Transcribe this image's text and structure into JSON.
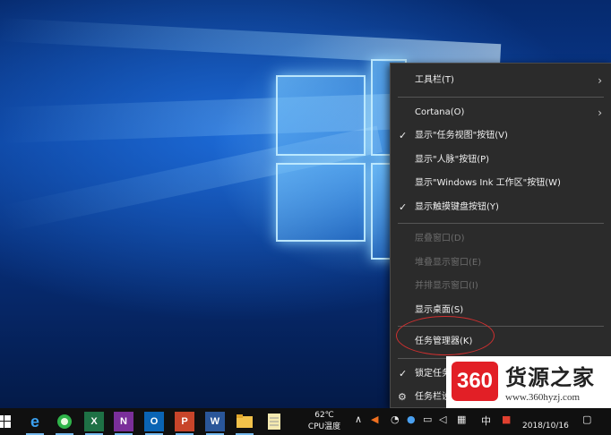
{
  "context_menu": {
    "items": [
      {
        "label": "工具栏(T)",
        "checked": false,
        "submenu": true,
        "enabled": true
      },
      {
        "label": "Cortana(O)",
        "checked": false,
        "submenu": true,
        "enabled": true
      },
      {
        "label": "显示\"任务视图\"按钮(V)",
        "checked": true,
        "submenu": false,
        "enabled": true
      },
      {
        "label": "显示\"人脉\"按钮(P)",
        "checked": false,
        "submenu": false,
        "enabled": true
      },
      {
        "label": "显示\"Windows Ink 工作区\"按钮(W)",
        "checked": false,
        "submenu": false,
        "enabled": true
      },
      {
        "label": "显示触摸键盘按钮(Y)",
        "checked": true,
        "submenu": false,
        "enabled": true
      },
      {
        "label": "层叠窗口(D)",
        "checked": false,
        "submenu": false,
        "enabled": false
      },
      {
        "label": "堆叠显示窗口(E)",
        "checked": false,
        "submenu": false,
        "enabled": false
      },
      {
        "label": "并排显示窗口(I)",
        "checked": false,
        "submenu": false,
        "enabled": false
      },
      {
        "label": "显示桌面(S)",
        "checked": false,
        "submenu": false,
        "enabled": true
      },
      {
        "label": "任务管理器(K)",
        "checked": false,
        "submenu": false,
        "enabled": true
      },
      {
        "label": "锁定任务",
        "checked": true,
        "submenu": false,
        "enabled": true
      },
      {
        "label": "任务栏设",
        "checked": false,
        "submenu": false,
        "enabled": true
      }
    ]
  },
  "watermark": {
    "badge": "360",
    "brand": "货源之家",
    "url": "www.360hyzj.com"
  },
  "taskbar": {
    "cpu_temp": "62℃",
    "cpu_label": "CPU温度",
    "ime": "中",
    "date": "2018/10/16",
    "icons": [
      "windows-start-icon",
      "edge-icon",
      "browser-360-icon",
      "excel-icon",
      "onenote-icon",
      "outlook-icon",
      "powerpoint-icon",
      "word-icon",
      "file-explorer-icon",
      "notepad-icon"
    ]
  },
  "colors": {
    "menu_bg": "#2b2b2b",
    "taskbar_bg": "#101010",
    "highlight_circle": "#d03030",
    "watermark_red": "#e21f26"
  }
}
